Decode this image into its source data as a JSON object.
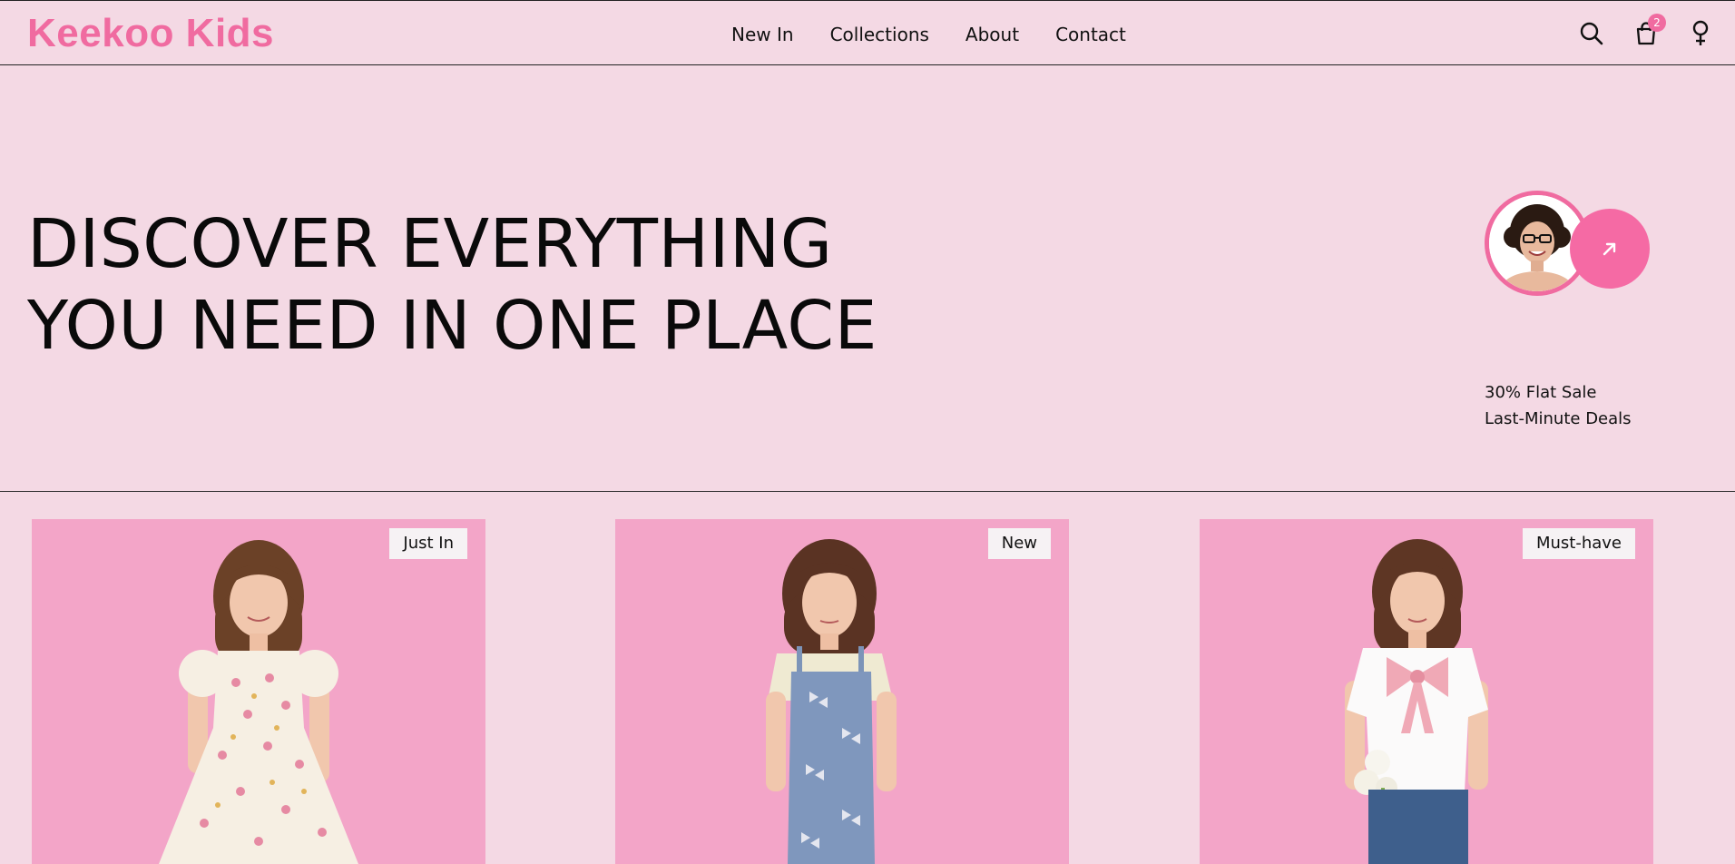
{
  "header": {
    "logo": "Keekoo Kids",
    "nav": [
      "New In",
      "Collections",
      "About",
      "Contact"
    ],
    "cart_count": "2",
    "icons": [
      "search-icon",
      "shopping-bag-icon",
      "female-symbol-icon"
    ]
  },
  "hero": {
    "title_line1": "DISCOVER EVERYTHING",
    "title_line2": "YOU NEED IN ONE PLACE",
    "promo": {
      "line1": "30% Flat Sale",
      "line2": "Last-Minute Deals",
      "arrow_icon": "arrow-up-right-icon"
    }
  },
  "products": [
    {
      "tag": "Just In"
    },
    {
      "tag": "New"
    },
    {
      "tag": "Must-have"
    }
  ],
  "colors": {
    "background": "#f4d9e4",
    "brand_pink": "#f06ba0",
    "card_pink": "#f3a5c8",
    "text": "#111111"
  }
}
